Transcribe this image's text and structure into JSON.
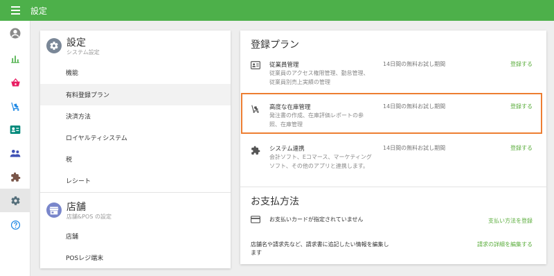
{
  "app": {
    "title": "設定"
  },
  "rail": {
    "items": [
      {
        "name": "account",
        "icon": "account-circle-icon"
      },
      {
        "name": "reports",
        "icon": "bar-chart-icon"
      },
      {
        "name": "sales",
        "icon": "basket-icon"
      },
      {
        "name": "inventory",
        "icon": "cart-icon"
      },
      {
        "name": "staff",
        "icon": "id-card-icon"
      },
      {
        "name": "customers",
        "icon": "people-icon"
      },
      {
        "name": "addons",
        "icon": "puzzle-icon"
      },
      {
        "name": "settings",
        "icon": "gear-icon",
        "active": true
      },
      {
        "name": "help",
        "icon": "help-icon"
      }
    ]
  },
  "settings_menu": {
    "system": {
      "title": "設定",
      "subtitle": "システム設定",
      "items": [
        {
          "label": "機能"
        },
        {
          "label": "有料登録プラン",
          "active": true
        },
        {
          "label": "決済方法"
        },
        {
          "label": "ロイヤルティシステム"
        },
        {
          "label": "税"
        },
        {
          "label": "レシート"
        }
      ]
    },
    "store": {
      "title": "店舗",
      "subtitle": "店舗&POS の設定",
      "items": [
        {
          "label": "店舗"
        },
        {
          "label": "POSレジ端末"
        }
      ]
    }
  },
  "plans": {
    "heading": "登録プラン",
    "rows": [
      {
        "name": "従業員管理",
        "desc": "従業員のアクセス権限管理、勤怠管理、従業員別売上実績の管理",
        "trial": "14日間の無料お試し期間",
        "action": "登録する",
        "icon": "id-card-icon"
      },
      {
        "name": "高度な在庫管理",
        "desc": "発注書の作成、在庫評価レポートの参照、在庫管理",
        "trial": "14日間の無料お試し期間",
        "action": "登録する",
        "icon": "cart-icon"
      },
      {
        "name": "システム連携",
        "desc": "会計ソフト、Eコマース、マーケティングソフト、その他のアプリと連携します。",
        "trial": "14日間の無料お試し期間",
        "action": "登録する",
        "icon": "puzzle-icon"
      }
    ]
  },
  "payment": {
    "heading": "お支払方法",
    "card_text": "お支払いカードが指定されていません",
    "card_action": "支払い方法を登録",
    "invoice_text": "店舗名や請求先など、請求書に追記したい情報を編集します",
    "invoice_action": "請求の詳細を編集する"
  },
  "colors": {
    "topbar": "#4db04a",
    "accent": "#5cae3e",
    "highlight": "#ed7d31"
  }
}
